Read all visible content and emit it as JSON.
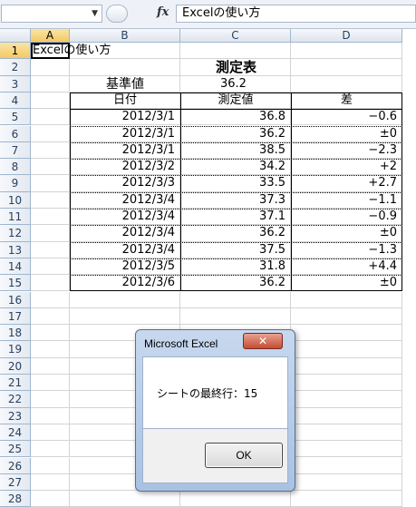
{
  "formula_bar": {
    "name_box": "",
    "fx": "fx",
    "formula": "Excelの使い方"
  },
  "columns": [
    "A",
    "B",
    "C",
    "D"
  ],
  "rows": [
    "1",
    "2",
    "3",
    "4",
    "5",
    "6",
    "7",
    "8",
    "9",
    "10",
    "11",
    "12",
    "13",
    "14",
    "15",
    "16",
    "17",
    "18",
    "19",
    "20",
    "21",
    "22",
    "23",
    "24",
    "25",
    "26",
    "27",
    "28"
  ],
  "sheet": {
    "a1": "Excelの使い方",
    "title": "測定表",
    "base_label": "基準値",
    "base_value": "36.2",
    "headers": [
      "日付",
      "測定値",
      "差"
    ],
    "table": [
      [
        "2012/3/1",
        "36.8",
        "−0.6"
      ],
      [
        "2012/3/1",
        "36.2",
        "±0"
      ],
      [
        "2012/3/1",
        "38.5",
        "−2.3"
      ],
      [
        "2012/3/2",
        "34.2",
        "+2"
      ],
      [
        "2012/3/3",
        "33.5",
        "+2.7"
      ],
      [
        "2012/3/4",
        "37.3",
        "−1.1"
      ],
      [
        "2012/3/4",
        "37.1",
        "−0.9"
      ],
      [
        "2012/3/4",
        "36.2",
        "±0"
      ],
      [
        "2012/3/4",
        "37.5",
        "−1.3"
      ],
      [
        "2012/3/5",
        "31.8",
        "+4.4"
      ],
      [
        "2012/3/6",
        "36.2",
        "±0"
      ]
    ]
  },
  "dialog": {
    "title": "Microsoft Excel",
    "close": "✕",
    "message": "シートの最終行：15",
    "ok": "OK"
  }
}
